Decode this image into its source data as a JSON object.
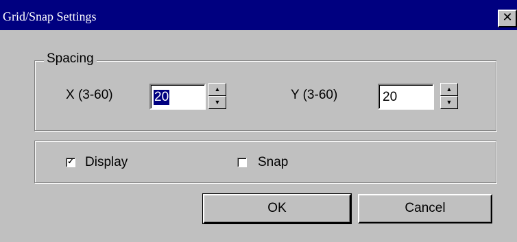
{
  "window": {
    "title": "Grid/Snap Settings",
    "close_glyph": "✕",
    "close_icon": "close-icon"
  },
  "spacing": {
    "label": "Spacing",
    "x": {
      "label": "X (3-60)",
      "value": "20",
      "selected": true
    },
    "y": {
      "label": "Y (3-60)",
      "value": "20",
      "selected": false
    }
  },
  "options": {
    "display": {
      "label": "Display",
      "checked": true,
      "mark": "✓"
    },
    "snap": {
      "label": "Snap",
      "checked": false,
      "mark": ""
    }
  },
  "buttons": {
    "ok": "OK",
    "cancel": "Cancel"
  },
  "spinner": {
    "up_glyph": "▲",
    "down_glyph": "▼"
  },
  "colors": {
    "titlebar": "#000080",
    "face": "#c0c0c0",
    "selection": "#000080"
  }
}
